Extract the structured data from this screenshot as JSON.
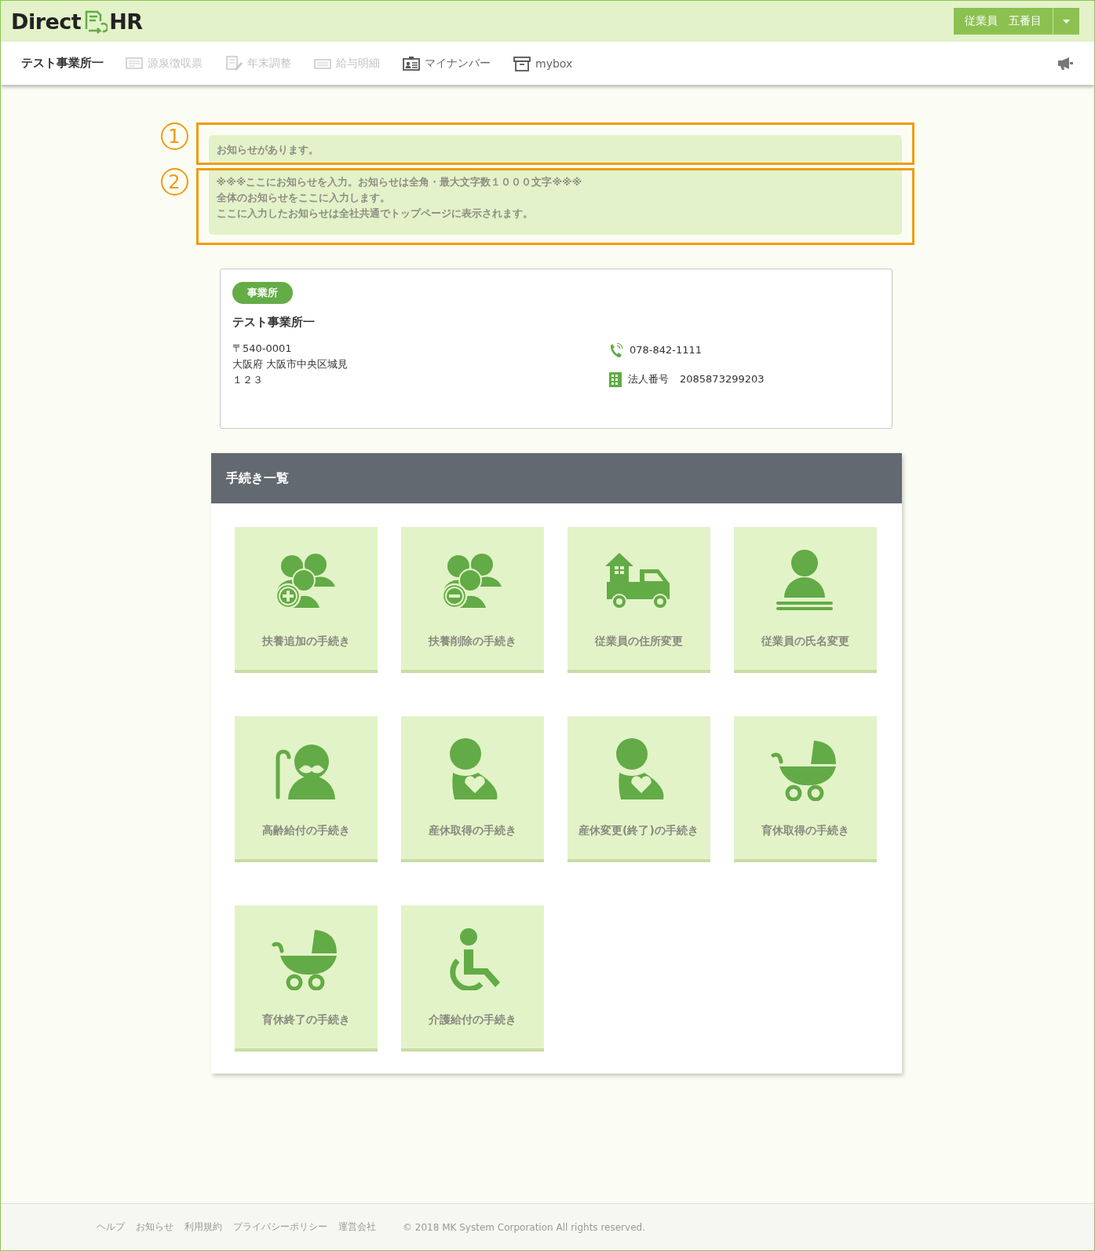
{
  "header": {
    "logo": {
      "left": "Direct",
      "right": "HR"
    },
    "user_menu": {
      "label": "従業員　五番目"
    }
  },
  "nav": {
    "office": "テスト事業所一",
    "items": [
      {
        "label": "源泉徴収票",
        "kind": "slip",
        "disabled": true
      },
      {
        "label": "年末調整",
        "kind": "adjust",
        "disabled": true
      },
      {
        "label": "給与明細",
        "kind": "pay",
        "disabled": true
      },
      {
        "label": "マイナンバー",
        "kind": "idcard",
        "disabled": false
      },
      {
        "label": "mybox",
        "kind": "box",
        "disabled": false
      }
    ]
  },
  "notices": [
    {
      "marker": "1",
      "lines": [
        "お知らせがあります。"
      ]
    },
    {
      "marker": "2",
      "lines": [
        "※※※ここにお知らせを入力。お知らせは全角・最大文字数１０００文字※※※",
        "全体のお知らせをここに入力します。",
        "ここに入力したお知らせは全社共通でトップページに表示されます。"
      ]
    }
  ],
  "office_card": {
    "badge": "事業所",
    "name": "テスト事業所一",
    "postal": "〒540-0001",
    "address": "大阪府 大阪市中央区城見",
    "address2": "１２３",
    "phone": "078-842-1111",
    "corp_label": "法人番号",
    "corp_number": "2085873299203"
  },
  "procedures": {
    "title": "手続き一覧",
    "items": [
      {
        "label": "扶養追加の手続き",
        "kind": "family-add"
      },
      {
        "label": "扶養削除の手続き",
        "kind": "family-remove"
      },
      {
        "label": "従業員の住所変更",
        "kind": "moving"
      },
      {
        "label": "従業員の氏名変更",
        "kind": "person"
      },
      {
        "label": "高齢給付の手続き",
        "kind": "elderly"
      },
      {
        "label": "産休取得の手続き",
        "kind": "maternity"
      },
      {
        "label": "産休変更(終了)の手続き",
        "kind": "maternity"
      },
      {
        "label": "育休取得の手続き",
        "kind": "stroller"
      },
      {
        "label": "育休終了の手続き",
        "kind": "stroller"
      },
      {
        "label": "介護給付の手続き",
        "kind": "wheelchair"
      }
    ]
  },
  "footer": {
    "links": [
      "ヘルプ",
      "お知らせ",
      "利用規約",
      "プライバシーポリシー",
      "運営会社"
    ],
    "copyright": "© 2018 MK System Corporation All rights reserved."
  }
}
